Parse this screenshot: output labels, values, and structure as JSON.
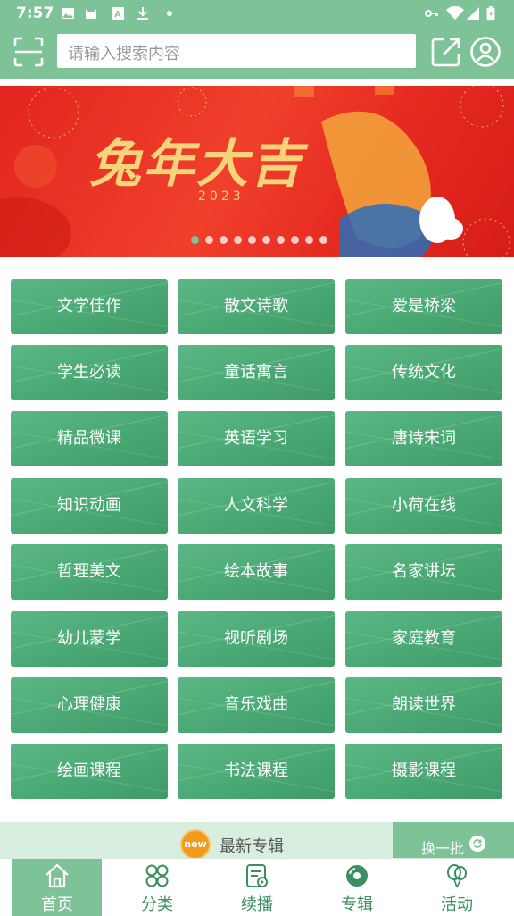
{
  "status_bar": {
    "time": "7:57"
  },
  "search": {
    "placeholder": "请输入搜索内容"
  },
  "banner": {
    "title": "兔年大吉",
    "year": "2023",
    "slide_count": 10,
    "active_slide": 1
  },
  "categories": [
    "文学佳作",
    "散文诗歌",
    "爱是桥梁",
    "学生必读",
    "童话寓言",
    "传统文化",
    "精品微课",
    "英语学习",
    "唐诗宋词",
    "知识动画",
    "人文科学",
    "小荷在线",
    "哲理美文",
    "绘本故事",
    "名家讲坛",
    "幼儿蒙学",
    "视听剧场",
    "家庭教育",
    "心理健康",
    "音乐戏曲",
    "朗读世界",
    "绘画课程",
    "书法课程",
    "摄影课程"
  ],
  "section": {
    "badge": "new",
    "title": "最新专辑",
    "refresh_label": "换一批"
  },
  "tabs": [
    {
      "label": "首页",
      "icon": "home-icon"
    },
    {
      "label": "分类",
      "icon": "category-icon"
    },
    {
      "label": "续播",
      "icon": "resume-play-icon"
    },
    {
      "label": "专辑",
      "icon": "album-icon"
    },
    {
      "label": "活动",
      "icon": "balloon-icon"
    }
  ],
  "colors": {
    "theme": "#7dc397",
    "tile": "#4aa874",
    "banner_red": "#e2251f",
    "badge_orange": "#f29a1b"
  }
}
